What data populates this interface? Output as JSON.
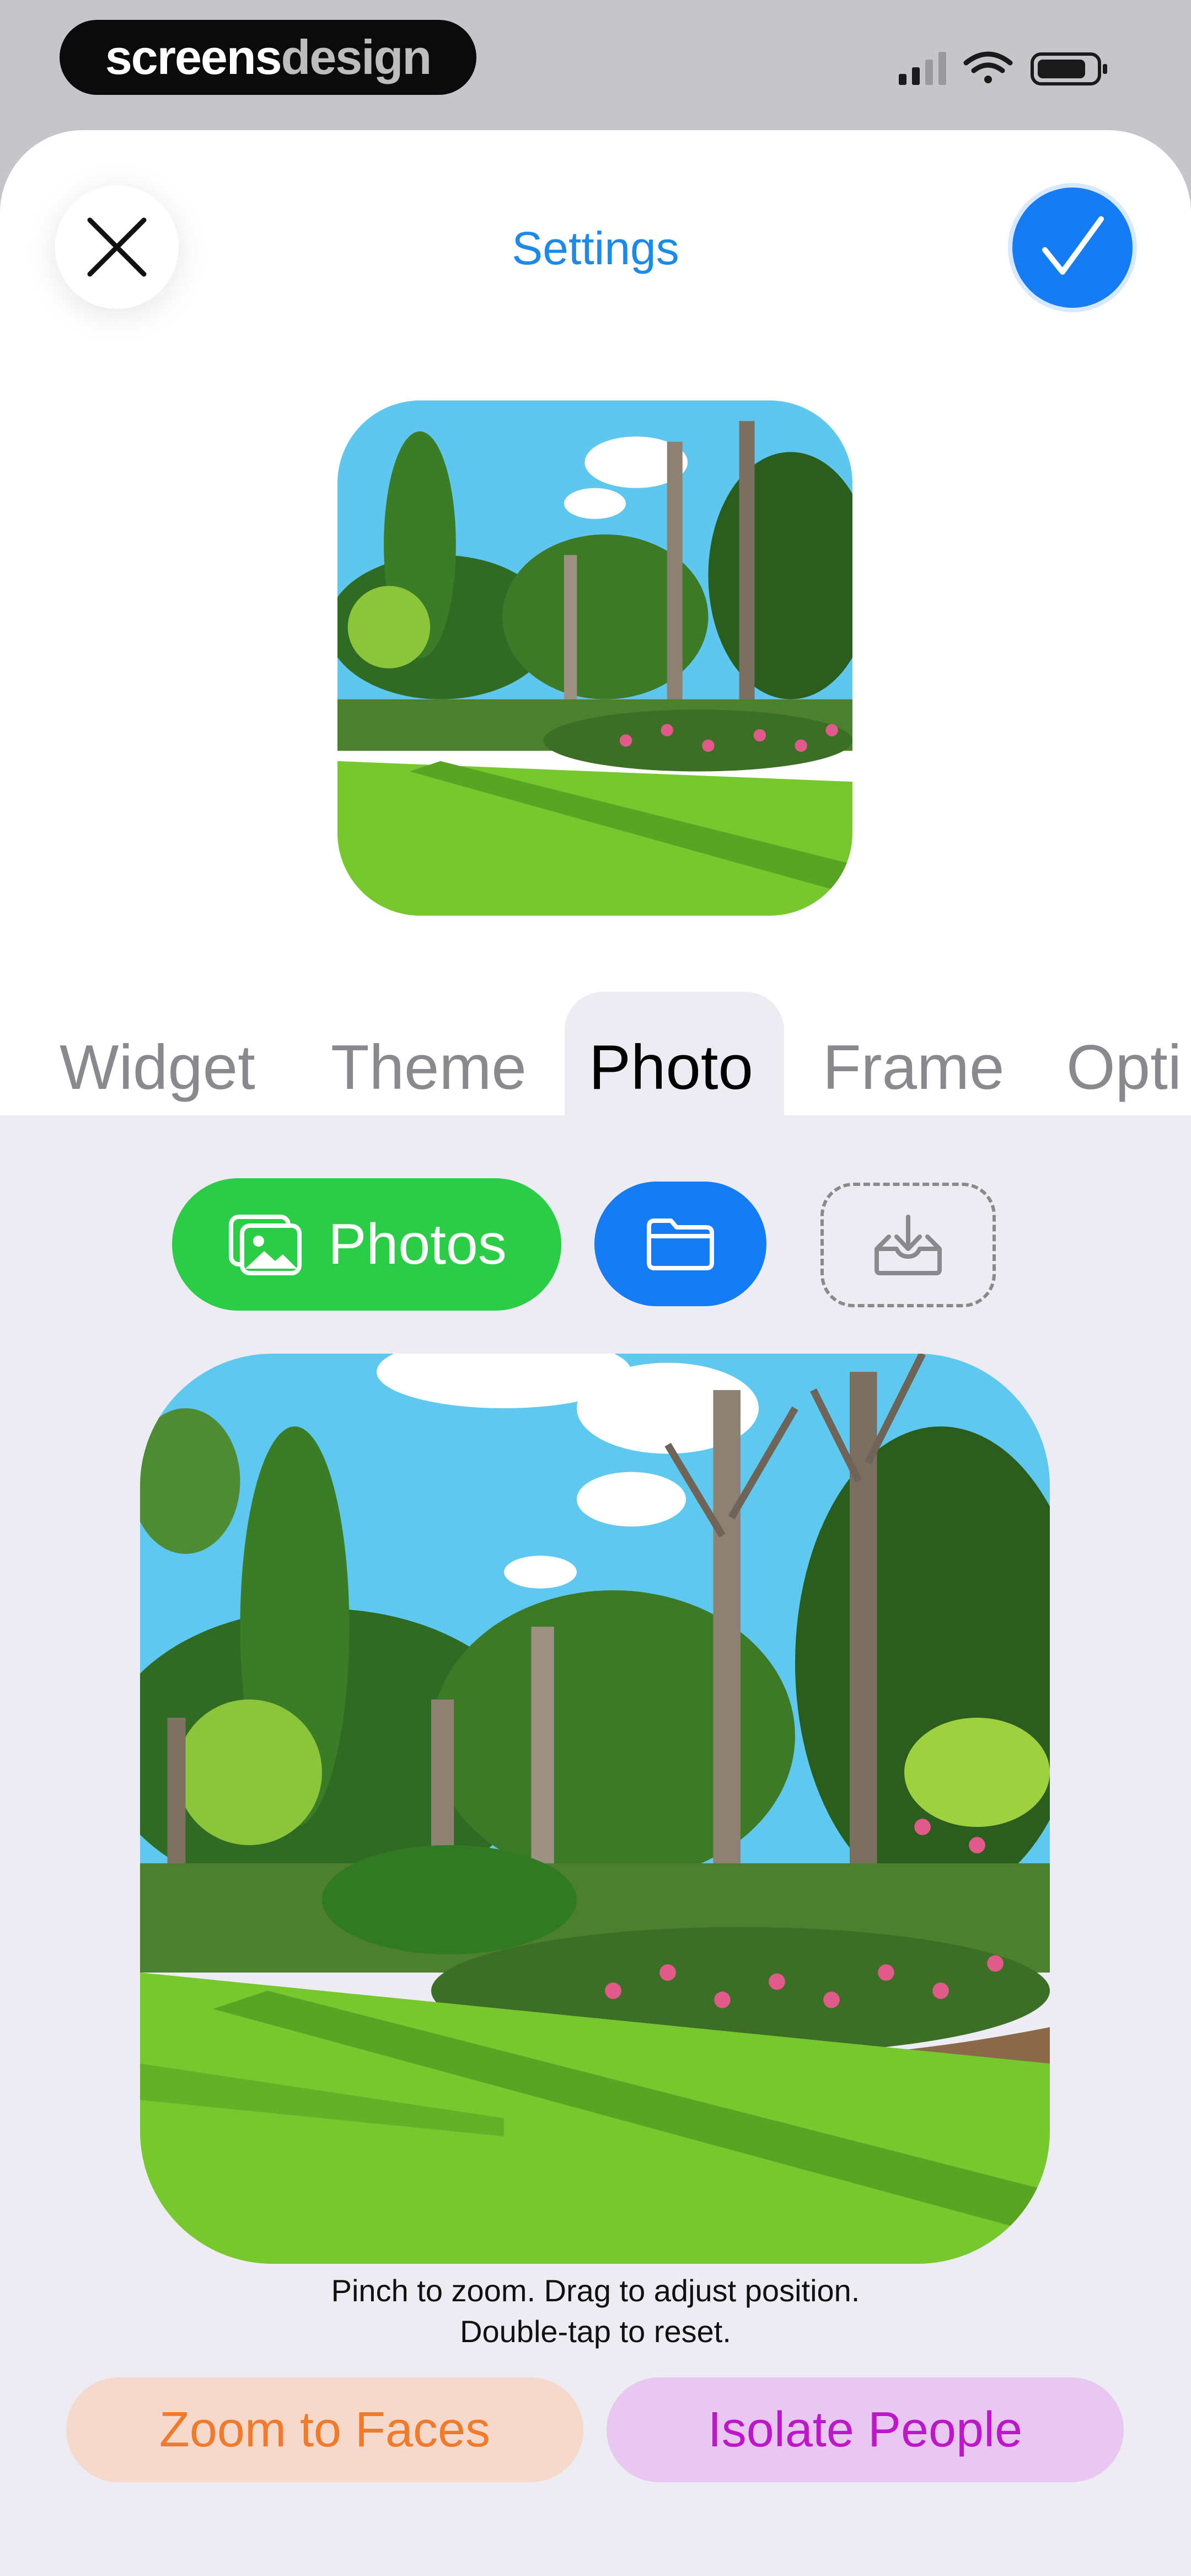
{
  "status_bar": {
    "brand_primary": "screens",
    "brand_secondary": "design",
    "icons": [
      "signal-icon",
      "wifi-icon",
      "battery-icon"
    ]
  },
  "header": {
    "title": "Settings",
    "close_icon": "close-icon",
    "confirm_icon": "checkmark-icon",
    "accent_color": "#157cf4"
  },
  "tabs": [
    {
      "label": "Widget",
      "active": false
    },
    {
      "label": "Theme",
      "active": false
    },
    {
      "label": "Photo",
      "active": true
    },
    {
      "label": "Frame",
      "active": false
    },
    {
      "label": "Opti",
      "active": false
    }
  ],
  "actions": {
    "photos_label": "Photos",
    "photos_icon": "photo-library-icon",
    "photos_color": "#2dcc48",
    "files_icon": "folder-icon",
    "import_icon": "tray-download-icon"
  },
  "editor": {
    "hint_line1": "Pinch to zoom. Drag to adjust position.",
    "hint_line2": "Double-tap to reset."
  },
  "buttons": {
    "zoom_faces": "Zoom to Faces",
    "isolate_people": "Isolate People",
    "zoom_faces_color": "#f07b2c",
    "isolate_people_color": "#bc18c9"
  }
}
